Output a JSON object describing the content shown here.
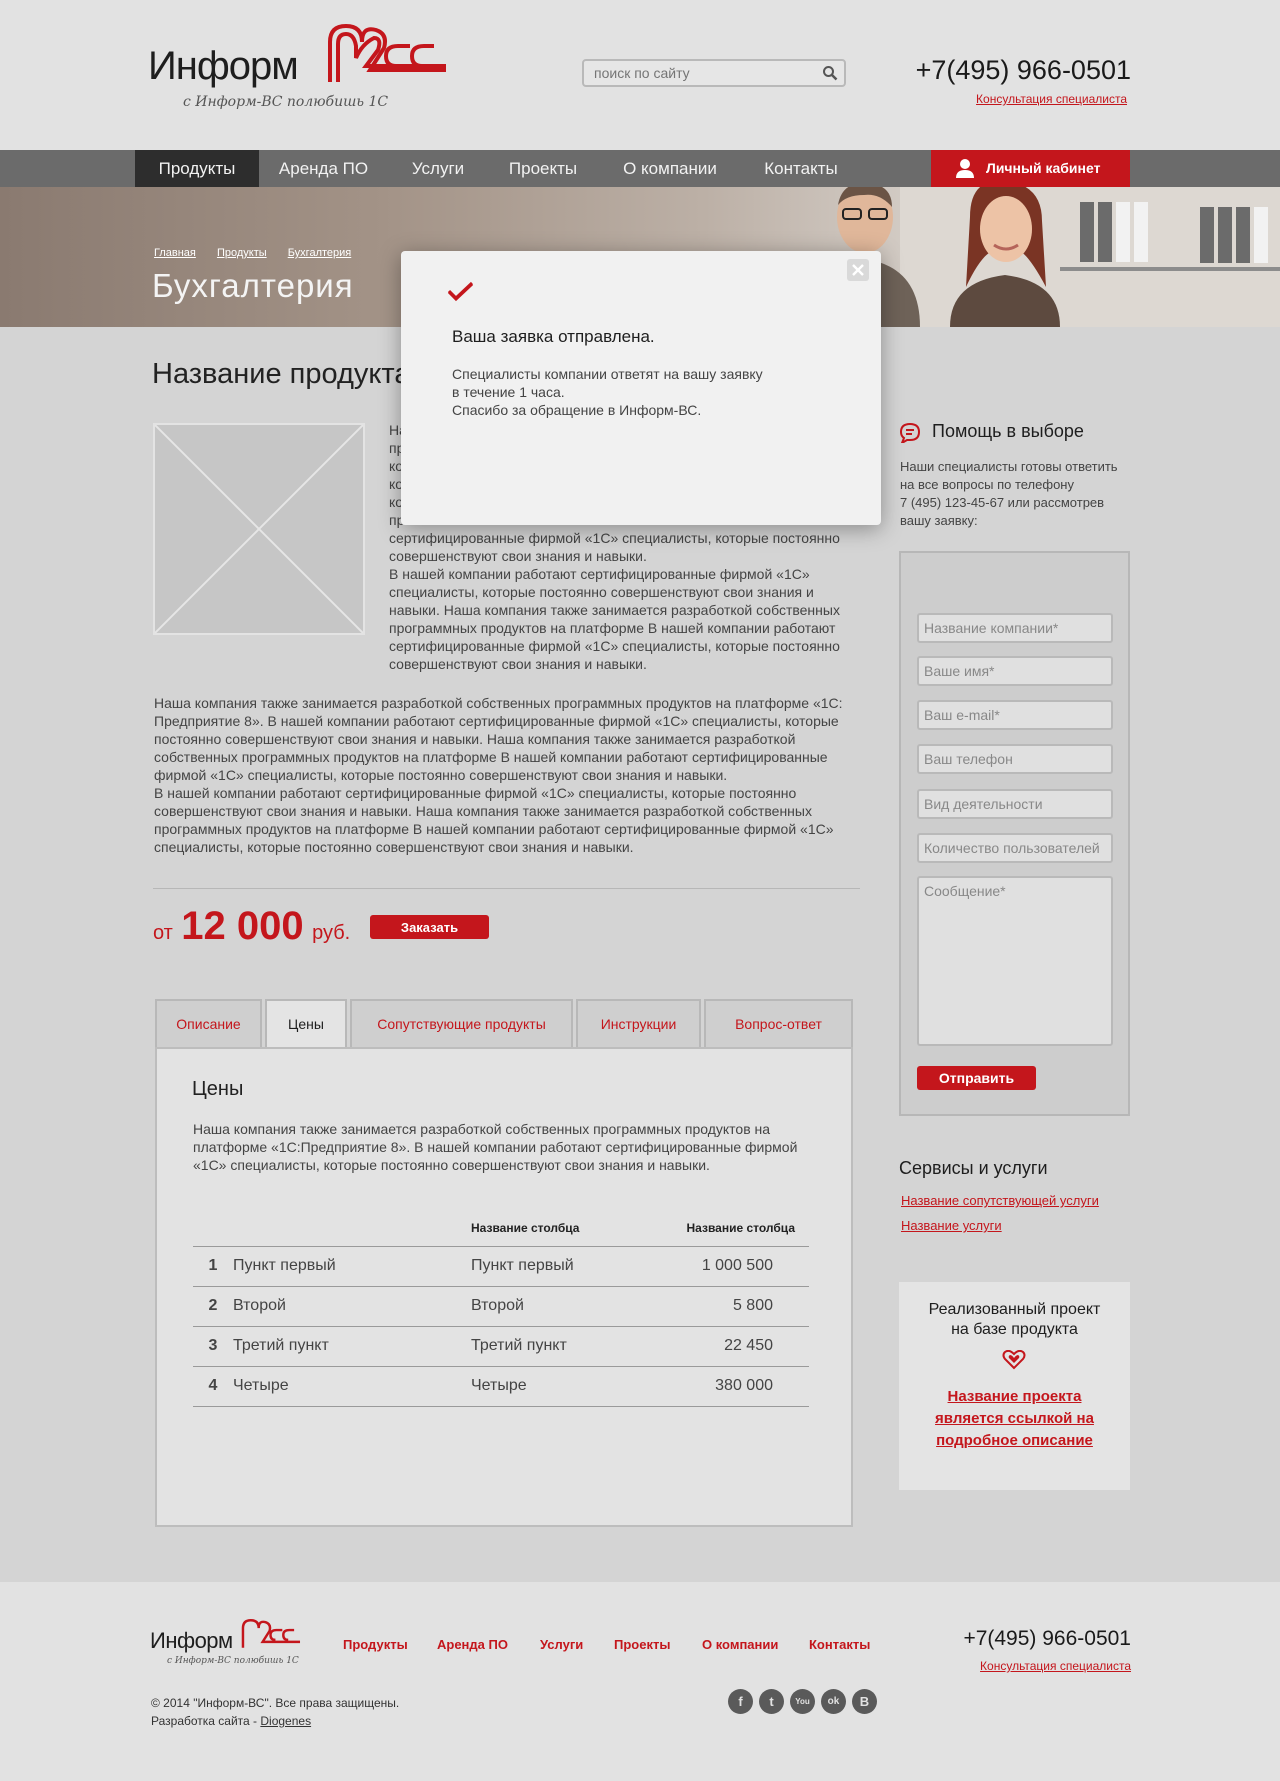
{
  "header": {
    "logo_word": "Информ",
    "logo_tagline": "с Информ-ВС полюбишь 1С",
    "search_placeholder": "поиск по сайту",
    "phone": "+7(495) 966-0501",
    "consult_link": "Консультация специалиста"
  },
  "nav": {
    "items": [
      "Продукты",
      "Аренда ПО",
      "Услуги",
      "Проекты",
      "О компании",
      "Контакты"
    ],
    "active": "Продукты",
    "cabinet_label": "Личный кабинет"
  },
  "banner": {
    "breadcrumb": [
      "Главная",
      "Продукты",
      "Бухгалтерия"
    ],
    "title": "Бухгалтерия"
  },
  "product": {
    "title": "Название продукта",
    "para1": "На… пр… ко… ко… ко… пр… сертифицированные фирмой «1С» специалисты, которые постоянно совершенствуют свои знания и навыки. В нашей компании работают сертифицированные фирмой «1С» специалисты, которые постоянно совершенствуют свои знания и навыки. Наша компания также занимается разработкой собственных программных продуктов на платформе  В нашей компании работают сертифицированные фирмой «1С» специалисты, которые постоянно совершенствуют свои знания и навыки.",
    "para1_lines": [
      "На",
      "пр",
      "ко",
      "ко",
      "ко",
      "пр",
      "сертифицированные фирмой «1С» специалисты, которые постоянно",
      "совершенствуют свои знания и навыки.",
      "В нашей компании работают сертифицированные фирмой «1С»",
      "специалисты, которые постоянно совершенствуют свои знания и",
      "навыки. Наша компания также занимается разработкой собственных",
      "программных продуктов на платформе  В нашей компании работают",
      "сертифицированные фирмой «1С» специалисты, которые постоянно",
      "совершенствуют свои знания и навыки."
    ],
    "para2_lines": [
      "Наша компания также занимается разработкой собственных программных продуктов на платформе «1С:",
      "Предприятие 8». В нашей компании работают сертифицированные фирмой «1С» специалисты, которые",
      "постоянно совершенствуют свои знания и навыки. Наша компания также занимается разработкой",
      "собственных программных продуктов на платформе  В нашей компании работают сертифицированные",
      "фирмой «1С» специалисты, которые постоянно совершенствуют свои знания и навыки.",
      "В нашей компании работают сертифицированные фирмой «1С» специалисты, которые постоянно",
      "совершенствуют свои знания и навыки. Наша компания также занимается разработкой собственных",
      "программных продуктов на платформе  В нашей компании работают сертифицированные фирмой «1С»",
      "специалисты, которые постоянно совершенствуют свои знания и навыки."
    ],
    "price_from": "от",
    "price_value": "12 000",
    "price_unit": "руб.",
    "order_label": "Заказать"
  },
  "tabs": {
    "items": [
      "Описание",
      "Цены",
      "Сопутствующие продукты",
      "Инструкции",
      "Вопрос-ответ"
    ],
    "active": "Цены",
    "panel_title": "Цены",
    "panel_text_lines": [
      "Наша компания также занимается разработкой собственных программных продуктов на",
      "платформе «1С:Предприятие 8». В нашей компании работают сертифицированные фирмой",
      "«1С» специалисты, которые постоянно совершенствуют свои знания и навыки."
    ],
    "table": {
      "headers": [
        "",
        "",
        "Название столбца",
        "Название столбца"
      ],
      "rows": [
        [
          "1",
          "Пункт первый",
          "Пункт первый",
          "1 000 500"
        ],
        [
          "2",
          "Второй",
          "Второй",
          "5 800"
        ],
        [
          "3",
          "Третий пункт",
          "Третий пункт",
          "22 450"
        ],
        [
          "4",
          "Четыре",
          "Четыре",
          "380 000"
        ]
      ]
    }
  },
  "sidebar": {
    "help_title": "Помощь в выборе",
    "help_text_lines": [
      "Наши специалисты готовы ответить",
      "на все вопросы по телефону",
      "7 (495) 123-45-67 или рассмотрев",
      "вашу заявку:"
    ],
    "form": {
      "fields": [
        "Название компании*",
        "Ваше имя*",
        "Ваш e-mail*",
        "Ваш телефон",
        "Вид деятельности",
        "Количество пользователей"
      ],
      "message_placeholder": "Сообщение*",
      "submit_label": "Отправить"
    },
    "services_title": "Сервисы и услуги",
    "services": [
      "Название сопутствующей услуги",
      "Название услуги"
    ],
    "project_title_lines": [
      "Реализованный проект",
      "на базе продукта"
    ],
    "project_link_lines": [
      "Название проекта",
      "является ссылкой на",
      "подробное описание"
    ]
  },
  "footer": {
    "logo_word": "Информ",
    "logo_tagline": "с Информ-ВС полюбишь 1С",
    "nav": [
      "Продукты",
      "Аренда ПО",
      "Услуги",
      "Проекты",
      "О компании",
      "Контакты"
    ],
    "phone": "+7(495) 966-0501",
    "consult_link": "Консультация специалиста",
    "copyright": "© 2014 \"Информ-ВС\". Все права защищены.",
    "dev_prefix": "Разработка сайта - ",
    "dev_link": "Diogenes",
    "social": [
      "f",
      "t",
      "You",
      "ok",
      "B"
    ],
    "social_icons": [
      "facebook-icon",
      "twitter-icon",
      "youtube-icon",
      "odnoklassniki-icon",
      "vkontakte-icon"
    ]
  },
  "modal": {
    "title": "Ваша заявка отправлена.",
    "text_lines": [
      "Специалисты компании ответят на вашу заявку",
      "в течение 1 часа.",
      "Спасибо за обращение в Информ-ВС."
    ]
  },
  "colors": {
    "accent": "#c4161c",
    "nav_bg": "#6b6b6b",
    "nav_active": "#2d2d2d",
    "page_bg": "#d4d4d4"
  }
}
